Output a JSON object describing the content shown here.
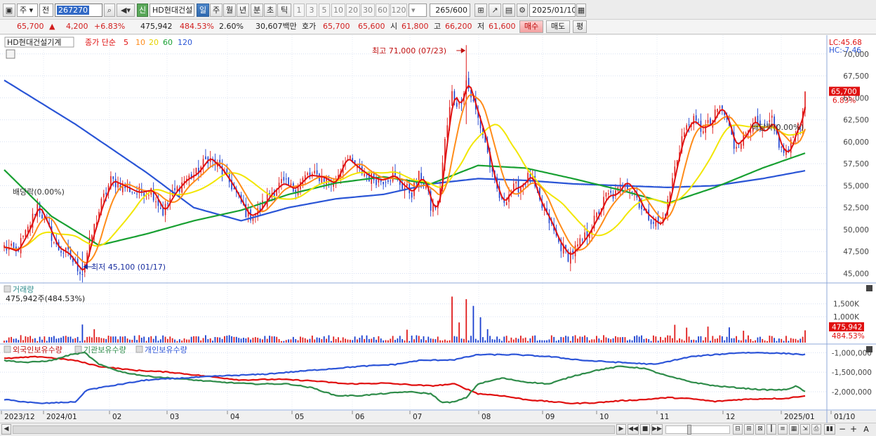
{
  "toolbar": {
    "period_select": "주",
    "prev_label": "전",
    "code": "267270",
    "badge": "신",
    "stock_name": "HD현대건설",
    "timeframes": [
      "일",
      "주",
      "월",
      "년",
      "분",
      "초",
      "틱"
    ],
    "active_timeframe": "일",
    "counts": [
      "1",
      "3",
      "5",
      "10",
      "20",
      "30",
      "60",
      "120"
    ],
    "bar_count": "265",
    "bar_max": "/600",
    "date": "2025/01/10"
  },
  "info": {
    "price": "65,700",
    "up_arrow": "▲",
    "change": "4,200",
    "change_pct": "+6.83%",
    "volume": "475,942",
    "volume_ratio": "484.53%",
    "turnover": "2.60%",
    "amount": "30,607백만",
    "quote_label": "호가",
    "ask": "65,700",
    "bid": "65,600",
    "open_label": "시",
    "open": "61,800",
    "high_label": "고",
    "high": "66,200",
    "low_label": "저",
    "low": "61,600",
    "buy_label": "매수",
    "sell_label": "매도",
    "avg_label": "평"
  },
  "colors": {
    "up": "#e01c1c",
    "down": "#1a3fcf",
    "ma5": "#e01010",
    "ma10": "#ff8c1a",
    "ma20": "#f2e600",
    "ma60": "#18a032",
    "ma120": "#2a55d6",
    "foreign": "#e01010",
    "institution": "#2f8c4a",
    "individual": "#2d55d8"
  },
  "chart_data": [
    {
      "type": "candlestick",
      "title": "HD현대건설기계",
      "legend": {
        "label": "종가 단순",
        "periods": [
          "5",
          "10",
          "20",
          "60",
          "120"
        ]
      },
      "x_labels": [
        "2023/12",
        "2024/01",
        "02",
        "03",
        "04",
        "05",
        "06",
        "07",
        "08",
        "09",
        "10",
        "11",
        "12",
        "2025/01",
        "01/10"
      ],
      "y_ticks": [
        "70,000",
        "67,500",
        "65,000",
        "62,500",
        "60,000",
        "57,500",
        "55,000",
        "52,500",
        "50,000",
        "47,500",
        "45,000"
      ],
      "ylim": [
        44000,
        71500
      ],
      "lc": "LC:45.68",
      "hc": "HC:-7.46",
      "current_price": "65,700",
      "current_pct": "6.83%",
      "annotations": {
        "high": "최고 71,000 (07/23)",
        "low": "최저 45,100 (01/17)",
        "dividend_left": "배당락(0.00%)",
        "dividend_right": "배당락(0.00%)"
      },
      "high_value": 71000,
      "low_value": 45100,
      "last_close": 65700,
      "trend_points": [
        [
          0,
          48000
        ],
        [
          5,
          47500
        ],
        [
          10,
          50000
        ],
        [
          14,
          52800
        ],
        [
          18,
          50500
        ],
        [
          22,
          48000
        ],
        [
          27,
          47200
        ],
        [
          30,
          46000
        ],
        [
          33,
          45100
        ],
        [
          36,
          48500
        ],
        [
          41,
          53000
        ],
        [
          45,
          55600
        ],
        [
          50,
          55000
        ],
        [
          56,
          54200
        ],
        [
          62,
          54500
        ],
        [
          67,
          52000
        ],
        [
          71,
          54000
        ],
        [
          76,
          55600
        ],
        [
          81,
          56400
        ],
        [
          86,
          58200
        ],
        [
          91,
          57000
        ],
        [
          96,
          55000
        ],
        [
          100,
          53000
        ],
        [
          103,
          51500
        ],
        [
          107,
          52000
        ],
        [
          112,
          54000
        ],
        [
          117,
          55300
        ],
        [
          122,
          54600
        ],
        [
          128,
          56200
        ],
        [
          134,
          56000
        ],
        [
          139,
          55200
        ],
        [
          144,
          58200
        ],
        [
          149,
          57000
        ],
        [
          154,
          56000
        ],
        [
          159,
          55600
        ],
        [
          164,
          56200
        ],
        [
          168,
          55000
        ],
        [
          172,
          54200
        ],
        [
          175,
          56000
        ],
        [
          178,
          55000
        ],
        [
          180,
          52500
        ],
        [
          183,
          52800
        ],
        [
          186,
          60000
        ],
        [
          189,
          65500
        ],
        [
          192,
          64000
        ],
        [
          195,
          67000
        ],
        [
          199,
          63500
        ],
        [
          203,
          60000
        ],
        [
          206,
          56000
        ],
        [
          210,
          53000
        ],
        [
          214,
          54500
        ],
        [
          218,
          55000
        ],
        [
          222,
          56200
        ],
        [
          226,
          53000
        ],
        [
          230,
          51000
        ],
        [
          234,
          48500
        ],
        [
          238,
          47000
        ],
        [
          242,
          48000
        ],
        [
          246,
          49500
        ],
        [
          250,
          51500
        ],
        [
          254,
          53800
        ],
        [
          258,
          54000
        ],
        [
          262,
          55500
        ],
        [
          266,
          54200
        ],
        [
          270,
          52000
        ],
        [
          274,
          51000
        ],
        [
          277,
          50500
        ],
        [
          280,
          53000
        ],
        [
          283,
          57000
        ],
        [
          286,
          60500
        ],
        [
          290,
          62500
        ],
        [
          294,
          61500
        ],
        [
          298,
          62000
        ],
        [
          302,
          64000
        ],
        [
          305,
          62500
        ],
        [
          308,
          59500
        ],
        [
          312,
          60500
        ],
        [
          316,
          62500
        ],
        [
          320,
          61000
        ],
        [
          324,
          62300
        ],
        [
          328,
          59000
        ],
        [
          331,
          58800
        ],
        [
          334,
          61500
        ],
        [
          336,
          62200
        ],
        [
          338,
          65700
        ]
      ],
      "ma_offsets": {
        "ma10": 3,
        "ma20": 8
      },
      "ma60_points": [
        [
          0,
          56800
        ],
        [
          20,
          51500
        ],
        [
          40,
          48200
        ],
        [
          60,
          49500
        ],
        [
          80,
          51000
        ],
        [
          100,
          52200
        ],
        [
          120,
          54000
        ],
        [
          140,
          55300
        ],
        [
          160,
          56000
        ],
        [
          180,
          55200
        ],
        [
          200,
          57300
        ],
        [
          220,
          57000
        ],
        [
          240,
          55800
        ],
        [
          260,
          54500
        ],
        [
          280,
          53000
        ],
        [
          300,
          54800
        ],
        [
          320,
          57000
        ],
        [
          338,
          58700
        ]
      ],
      "ma120_points": [
        [
          0,
          67000
        ],
        [
          30,
          62000
        ],
        [
          60,
          56500
        ],
        [
          80,
          52500
        ],
        [
          100,
          51000
        ],
        [
          120,
          52500
        ],
        [
          140,
          53500
        ],
        [
          160,
          54000
        ],
        [
          180,
          55200
        ],
        [
          200,
          55800
        ],
        [
          220,
          55600
        ],
        [
          240,
          55200
        ],
        [
          260,
          55000
        ],
        [
          280,
          54800
        ],
        [
          300,
          55000
        ],
        [
          320,
          55800
        ],
        [
          338,
          56700
        ]
      ]
    },
    {
      "type": "bar",
      "title": "거래량",
      "value_label": "475,942주(484.53%)",
      "y_ticks": [
        "1,500K",
        "1,000K"
      ],
      "ylim": [
        0,
        1900000
      ],
      "last_value": "475,942",
      "last_pct": "484.53%",
      "spikes": [
        {
          "index": 33,
          "value": 700000
        },
        {
          "index": 38,
          "value": 520000
        },
        {
          "index": 170,
          "value": 500000
        },
        {
          "index": 189,
          "value": 1780000
        },
        {
          "index": 192,
          "value": 780000
        },
        {
          "index": 195,
          "value": 1680000
        },
        {
          "index": 198,
          "value": 1420000
        },
        {
          "index": 201,
          "value": 980000
        },
        {
          "index": 204,
          "value": 520000
        },
        {
          "index": 283,
          "value": 690000
        },
        {
          "index": 288,
          "value": 580000
        },
        {
          "index": 297,
          "value": 620000
        },
        {
          "index": 306,
          "value": 590000
        },
        {
          "index": 312,
          "value": 460000
        },
        {
          "index": 338,
          "value": 475942
        }
      ]
    },
    {
      "type": "line",
      "title": "외국인보유수량",
      "series": [
        {
          "name": "외국인보유수량",
          "points": [
            [
              0,
              -1150000
            ],
            [
              15,
              -1100000
            ],
            [
              30,
              -1200000
            ],
            [
              40,
              -1350000
            ],
            [
              55,
              -1450000
            ],
            [
              70,
              -1500000
            ],
            [
              85,
              -1600000
            ],
            [
              100,
              -1700000
            ],
            [
              115,
              -1680000
            ],
            [
              130,
              -1720000
            ],
            [
              145,
              -1800000
            ],
            [
              160,
              -1780000
            ],
            [
              180,
              -1850000
            ],
            [
              190,
              -1800000
            ],
            [
              200,
              -2050000
            ],
            [
              210,
              -2100000
            ],
            [
              220,
              -2200000
            ],
            [
              230,
              -2250000
            ],
            [
              240,
              -2300000
            ],
            [
              250,
              -2280000
            ],
            [
              260,
              -2230000
            ],
            [
              270,
              -2200000
            ],
            [
              280,
              -2150000
            ],
            [
              290,
              -2180000
            ],
            [
              300,
              -2250000
            ],
            [
              310,
              -2200000
            ],
            [
              320,
              -2180000
            ],
            [
              330,
              -2170000
            ],
            [
              338,
              -2100000
            ]
          ]
        },
        {
          "name": "기관보유수량",
          "points": [
            [
              0,
              -1200000
            ],
            [
              10,
              -1250000
            ],
            [
              20,
              -1200000
            ],
            [
              28,
              -1050000
            ],
            [
              34,
              -1000000
            ],
            [
              40,
              -1300000
            ],
            [
              50,
              -1500000
            ],
            [
              60,
              -1600000
            ],
            [
              70,
              -1650000
            ],
            [
              80,
              -1700000
            ],
            [
              90,
              -1750000
            ],
            [
              105,
              -1800000
            ],
            [
              120,
              -1800000
            ],
            [
              130,
              -1900000
            ],
            [
              140,
              -2100000
            ],
            [
              150,
              -2100000
            ],
            [
              160,
              -2050000
            ],
            [
              170,
              -2000000
            ],
            [
              180,
              -2050000
            ],
            [
              185,
              -2280000
            ],
            [
              190,
              -2260000
            ],
            [
              195,
              -2150000
            ],
            [
              200,
              -1800000
            ],
            [
              210,
              -1650000
            ],
            [
              220,
              -1750000
            ],
            [
              230,
              -1800000
            ],
            [
              240,
              -1600000
            ],
            [
              250,
              -1450000
            ],
            [
              260,
              -1350000
            ],
            [
              270,
              -1400000
            ],
            [
              280,
              -1600000
            ],
            [
              290,
              -1750000
            ],
            [
              300,
              -1850000
            ],
            [
              310,
              -1900000
            ],
            [
              320,
              -1950000
            ],
            [
              330,
              -1950000
            ],
            [
              334,
              -1850000
            ],
            [
              338,
              -2000000
            ]
          ]
        },
        {
          "name": "개인보유수량",
          "points": [
            [
              0,
              -2200000
            ],
            [
              15,
              -2300000
            ],
            [
              30,
              -2260000
            ],
            [
              35,
              -1950000
            ],
            [
              45,
              -1850000
            ],
            [
              60,
              -1700000
            ],
            [
              75,
              -1650000
            ],
            [
              90,
              -1600000
            ],
            [
              110,
              -1550000
            ],
            [
              130,
              -1450000
            ],
            [
              150,
              -1350000
            ],
            [
              165,
              -1300000
            ],
            [
              175,
              -1200000
            ],
            [
              190,
              -1180000
            ],
            [
              200,
              -1050000
            ],
            [
              215,
              -1050000
            ],
            [
              230,
              -1100000
            ],
            [
              245,
              -1200000
            ],
            [
              260,
              -1250000
            ],
            [
              275,
              -1300000
            ],
            [
              282,
              -1200000
            ],
            [
              290,
              -1100000
            ],
            [
              300,
              -1050000
            ],
            [
              310,
              -1000000
            ],
            [
              320,
              -1000000
            ],
            [
              330,
              -1020000
            ],
            [
              338,
              -1050000
            ]
          ]
        }
      ],
      "legend": [
        "외국인보유수량",
        "기관보유수량",
        "개인보유수량"
      ],
      "y_ticks": [
        "-1,000,000",
        "-1,500,000",
        "-2,000,000"
      ],
      "ylim": [
        -2450000,
        -850000
      ]
    }
  ]
}
